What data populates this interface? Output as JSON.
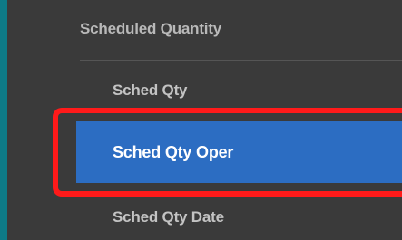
{
  "menu": {
    "section_header": "Scheduled Quantity",
    "items": [
      {
        "label": "Sched Qty"
      },
      {
        "label": "Sched Qty Oper",
        "selected": true
      },
      {
        "label": "Sched Qty Date"
      }
    ]
  },
  "colors": {
    "background": "#3a3a3a",
    "accent_edge": "#0e7a86",
    "selected": "#2c6dc2",
    "highlight_border": "#ff1a1a"
  }
}
